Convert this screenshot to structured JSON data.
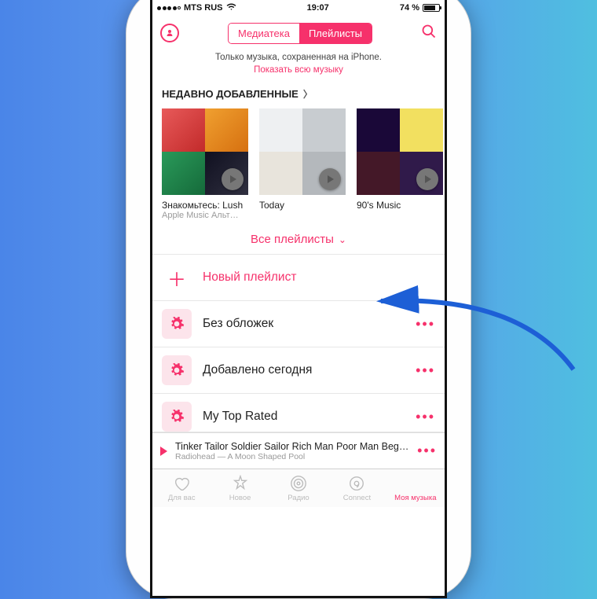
{
  "status": {
    "carrier": "MTS RUS",
    "time": "19:07",
    "battery_text": "74 %"
  },
  "header": {
    "segment": {
      "library": "Медиатека",
      "playlists": "Плейлисты"
    }
  },
  "notice": {
    "line1": "Только музыка, сохраненная на iPhone.",
    "link": "Показать всю музыку"
  },
  "recent": {
    "title": "НЕДАВНО ДОБАВЛЕННЫЕ",
    "items": [
      {
        "title": "Знакомьтесь: Lush",
        "sub": "Apple Music Альт…"
      },
      {
        "title": "Today",
        "sub": ""
      },
      {
        "title": "90's Music",
        "sub": ""
      }
    ]
  },
  "all_playlists_label": "Все плейлисты",
  "playlists": {
    "new": "Новый плейлист",
    "items": [
      "Без обложек",
      "Добавлено сегодня",
      "My Top Rated"
    ]
  },
  "now_playing": {
    "title": "Tinker Tailor Soldier Sailor Rich Man Poor Man Begg…",
    "artist": "Radiohead — A Moon Shaped Pool"
  },
  "tabs": {
    "for_you": "Для вас",
    "new": "Новое",
    "radio": "Радио",
    "connect": "Connect",
    "my_music": "Моя музыка"
  }
}
